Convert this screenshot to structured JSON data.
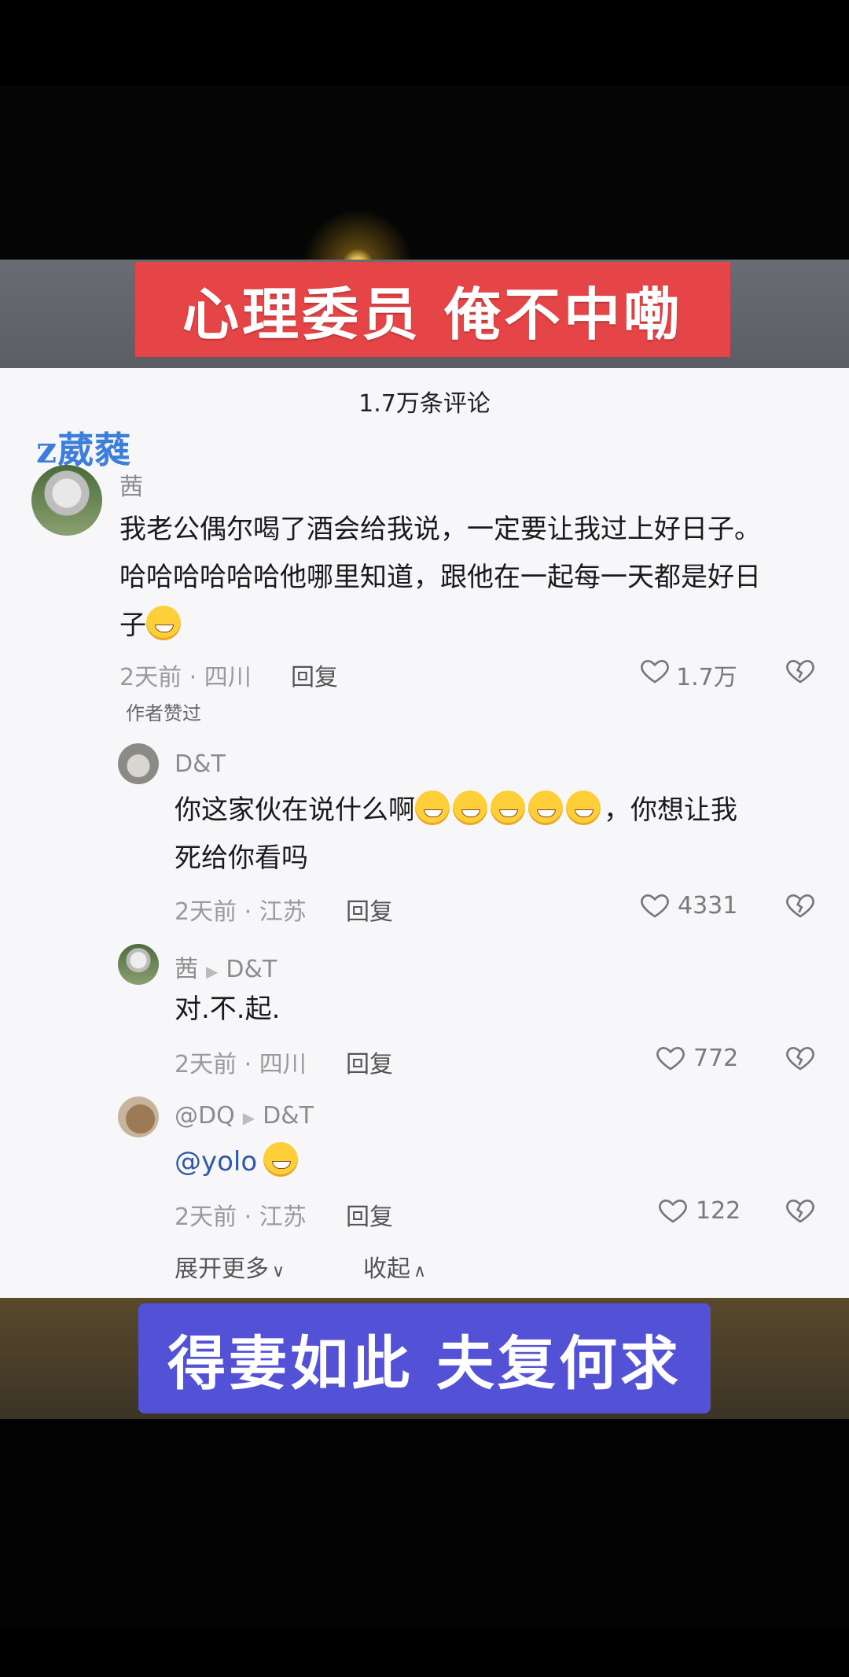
{
  "banner_top": "心理委员   俺不中嘞",
  "header": {
    "comment_count": "1.7万条评论"
  },
  "watermark": "z葳蕤",
  "comments": [
    {
      "user": "茜",
      "text_line1": "我老公偶尔喝了酒会给我说，一定要让我过上好日子。",
      "text_line2": "哈哈哈哈哈哈他哪里知道，跟他在一起每一天都是好日",
      "text_line3": "子",
      "meta": "2天前 · 四川",
      "reply": "回复",
      "likes": "1.7万",
      "author_liked": "作者赞过"
    },
    {
      "user": "D&T",
      "text_line1_a": "你这家伙在说什么啊",
      "text_line1_b": "，你想让我",
      "text_line2": "死给你看吗",
      "meta": "2天前 · 江苏",
      "reply": "回复",
      "likes": "4331"
    },
    {
      "user": "茜",
      "reply_to": "D&T",
      "text": "对.不.起.",
      "meta": "2天前 · 四川",
      "reply": "回复",
      "likes": "772"
    },
    {
      "user": "@DQ",
      "reply_to": "D&T",
      "text": "@yolo",
      "meta": "2天前 · 江苏",
      "reply": "回复",
      "likes": "122"
    }
  ],
  "expand_more": "展开更多",
  "collapse": "收起",
  "banner_bottom": "得妻如此 夫复何求",
  "colors": {
    "banner_top_bg": "#e64547",
    "banner_bottom_bg": "#5352d6",
    "panel_bg": "#f7f7f9"
  }
}
